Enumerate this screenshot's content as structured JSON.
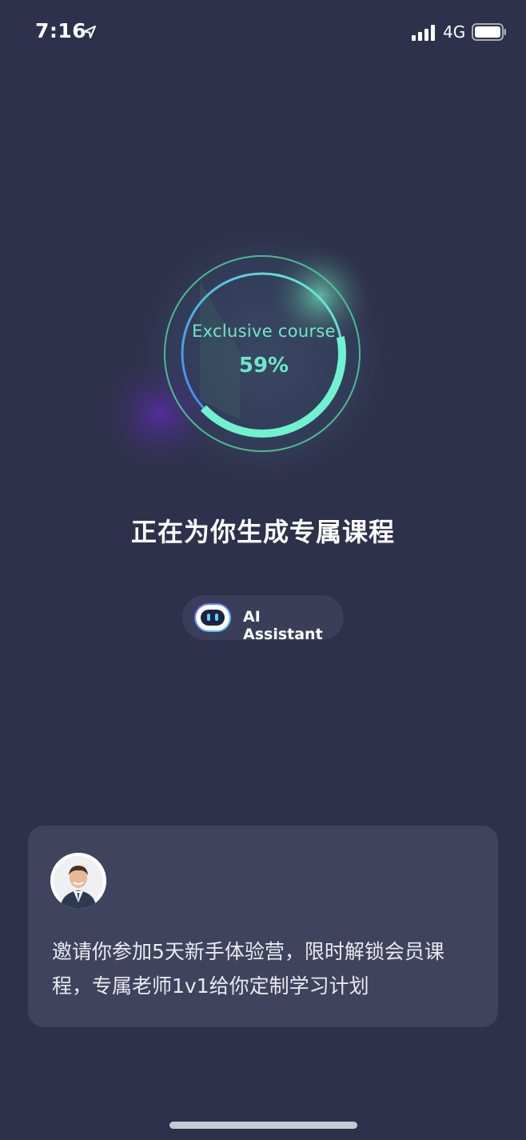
{
  "status_bar": {
    "time": "7:16",
    "network": "4G",
    "icons": [
      "location-arrow-icon",
      "signal-icon",
      "battery-icon"
    ]
  },
  "progress": {
    "label": "Exclusive course",
    "percent_text": "59%",
    "value": 0.59,
    "colors": {
      "ring_start": "#3d7ff0",
      "ring_end": "#6ff2d0",
      "outer_ring": "#4fd1a0"
    }
  },
  "generating": {
    "title": "正在为你生成专属课程"
  },
  "assistant": {
    "label": "AI Assistant",
    "icon": "robot-icon"
  },
  "invite": {
    "avatar": "teacher-avatar",
    "text": "邀请你参加5天新手体验营，限时解锁会员课程，专属老师1v1给你定制学习计划"
  },
  "theme": {
    "background": "#2e314b",
    "card": "#40435d",
    "accent": "#6fe7c8"
  }
}
